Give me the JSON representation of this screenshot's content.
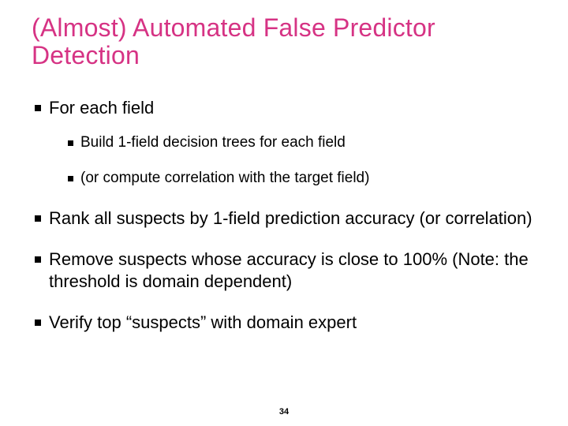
{
  "title": "(Almost) Automated False Predictor Detection",
  "bullets": [
    {
      "text": "For each field",
      "children": [
        {
          "text": "Build 1-field decision trees for each field"
        },
        {
          "text": "(or compute correlation with the target field)"
        }
      ]
    },
    {
      "text": "Rank all suspects by 1-field prediction accuracy (or correlation)"
    },
    {
      "text": "Remove suspects whose accuracy is close to 100% (Note: the threshold is domain dependent)"
    },
    {
      "text": "Verify top “suspects” with domain expert"
    }
  ],
  "page_number": "34"
}
